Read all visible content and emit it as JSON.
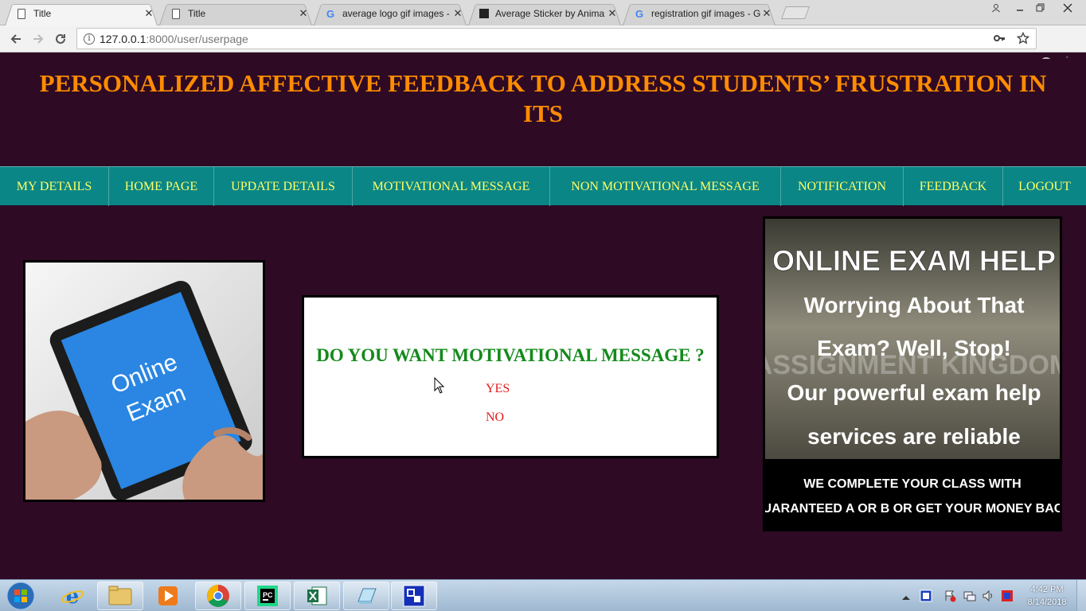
{
  "browser": {
    "tabs": [
      {
        "label": "Title",
        "icon": "page-icon",
        "active": true
      },
      {
        "label": "Title",
        "icon": "page-icon",
        "active": false
      },
      {
        "label": "average logo gif images - G",
        "icon": "google-icon",
        "active": false
      },
      {
        "label": "Average Sticker by Anima",
        "icon": "sticker-icon",
        "active": false
      },
      {
        "label": "registration gif images - G",
        "icon": "google-icon",
        "active": false
      }
    ],
    "url_host": "127.0.0.1",
    "url_path": ":8000/user/userpage"
  },
  "page": {
    "title": "PERSONALIZED AFFECTIVE FEEDBACK TO ADDRESS STUDENTS’ FRUSTRATION IN ITS",
    "nav": [
      {
        "label": "MY DETAILS"
      },
      {
        "label": "HOME PAGE"
      },
      {
        "label": "UPDATE DETAILS"
      },
      {
        "label": "MOTIVATIONAL MESSAGE"
      },
      {
        "label": "NON MOTIVATIONAL MESSAGE"
      },
      {
        "label": "NOTIFICATION"
      },
      {
        "label": "FEEDBACK"
      },
      {
        "label": "LOGOUT"
      }
    ],
    "prompt": {
      "question": "DO YOU WANT MOTIVATIONAL MESSAGE ?",
      "yes_label": "YES",
      "no_label": "NO"
    },
    "left_image": {
      "screen_text_1": "Online",
      "screen_text_2": "Exam"
    },
    "right_image": {
      "heading": "ONLINE EXAM HELP",
      "line1": "Worrying About That",
      "line2": "Exam? Well, Stop!",
      "line3": "Our powerful exam help",
      "line4": "services are reliable",
      "watermark": "ASSIGNMENT KINGDOM",
      "footer1": "WE COMPLETE YOUR CLASS WITH",
      "footer2": "GUARANTEED A OR B OR GET YOUR MONEY BACK"
    },
    "colors": {
      "background": "#2e0a24",
      "title": "#ff8c00",
      "nav_bg": "#0a8686",
      "nav_text": "#ffff66",
      "question": "#138a1a",
      "option": "#e21b1b"
    }
  },
  "taskbar": {
    "apps": [
      "internet-explorer-icon",
      "file-explorer-icon",
      "media-player-icon",
      "chrome-icon",
      "pycharm-icon",
      "excel-icon",
      "notepad-icon",
      "app-icon"
    ],
    "pycharm_text": "PC",
    "time": "4:42 PM",
    "date": "8/14/2018"
  }
}
